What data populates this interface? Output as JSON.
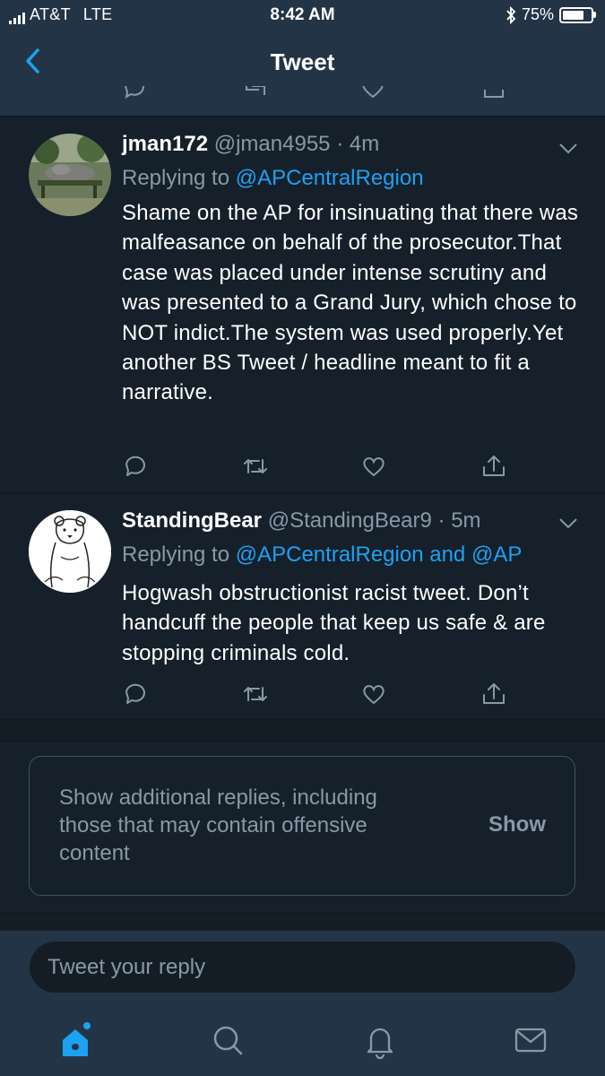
{
  "status_bar": {
    "carrier": "AT&T",
    "network": "LTE",
    "time": "8:42 AM",
    "battery_percent": "75%",
    "battery_level": 0.75
  },
  "nav": {
    "title": "Tweet",
    "back_icon": "chevron-left-icon"
  },
  "tweets": [
    {
      "name": "jman172",
      "handle": "@jman4955",
      "separator": "·",
      "time": "4m",
      "replying_prefix": "Replying to",
      "mentions": [
        "@APCentralRegion"
      ],
      "body": "Shame on the AP for insinuating that there was malfeasance on behalf of the prosecutor.That case was placed under intense scrutiny and was presented to a Grand Jury, which chose to NOT indict.The system was used properly.Yet another BS Tweet / headline meant to fit a narrative."
    },
    {
      "name": "StandingBear",
      "handle": "@StandingBear9",
      "separator": "·",
      "time": "5m",
      "replying_prefix": "Replying to",
      "mentions": [
        "@APCentralRegion",
        "@AP"
      ],
      "mention_joiner": "and",
      "body": "Hogwash obstructionist racist tweet. Don’t handcuff the people that keep us safe & are stopping criminals cold."
    }
  ],
  "notice": {
    "text": "Show additional replies, including those that may contain offensive content",
    "button": "Show"
  },
  "reply": {
    "placeholder": "Tweet your reply"
  },
  "tabs": [
    "home-icon",
    "search-icon",
    "notifications-bell-icon",
    "messages-envelope-icon"
  ],
  "colors": {
    "background": "#141d26",
    "header": "#243447",
    "accent": "#1da1f2",
    "muted": "#8899a6",
    "divider": "#10171e"
  }
}
